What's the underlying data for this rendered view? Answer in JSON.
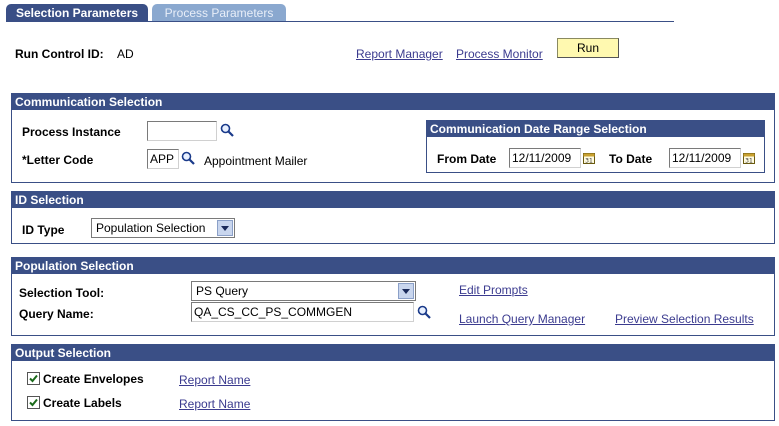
{
  "tabs": [
    {
      "label": "Selection Parameters",
      "active": true
    },
    {
      "label": "Process Parameters",
      "active": false
    }
  ],
  "run_control": {
    "label": "Run Control ID:",
    "value": "AD",
    "report_manager": "Report Manager",
    "process_monitor": "Process Monitor",
    "run_label": "Run"
  },
  "communication_selection": {
    "title": "Communication Selection",
    "process_instance_label": "Process Instance",
    "process_instance_value": "",
    "letter_code_label": "*Letter Code",
    "letter_code_value": "APP",
    "letter_code_desc": "Appointment Mailer",
    "date_range": {
      "title": "Communication Date Range Selection",
      "from_label": "From Date",
      "from_value": "12/11/2009",
      "to_label": "To Date",
      "to_value": "12/11/2009"
    }
  },
  "id_selection": {
    "title": "ID Selection",
    "id_type_label": "ID Type",
    "id_type_value": "Population Selection"
  },
  "population_selection": {
    "title": "Population Selection",
    "selection_tool_label": "Selection Tool:",
    "selection_tool_value": "PS Query",
    "query_name_label": "Query Name:",
    "query_name_value": "QA_CS_CC_PS_COMMGEN",
    "edit_prompts": "Edit Prompts",
    "launch_query_manager": "Launch Query Manager",
    "preview_selection_results": "Preview Selection Results"
  },
  "output_selection": {
    "title": "Output Selection",
    "envelopes_label": "Create Envelopes",
    "envelopes_checked": true,
    "envelopes_link": "Report Name",
    "labels_label": "Create Labels",
    "labels_checked": true,
    "labels_link": "Report Name"
  },
  "icons": {
    "lookup": "magnifier-icon",
    "calendar": "calendar-icon",
    "check": "check-icon",
    "dropdown": "chevron-down-icon"
  },
  "colors": {
    "header_bg": "#3a4f86",
    "inactive_tab": "#8aa8cf",
    "run_button": "#fff9b0",
    "link": "#3b3b8f"
  }
}
